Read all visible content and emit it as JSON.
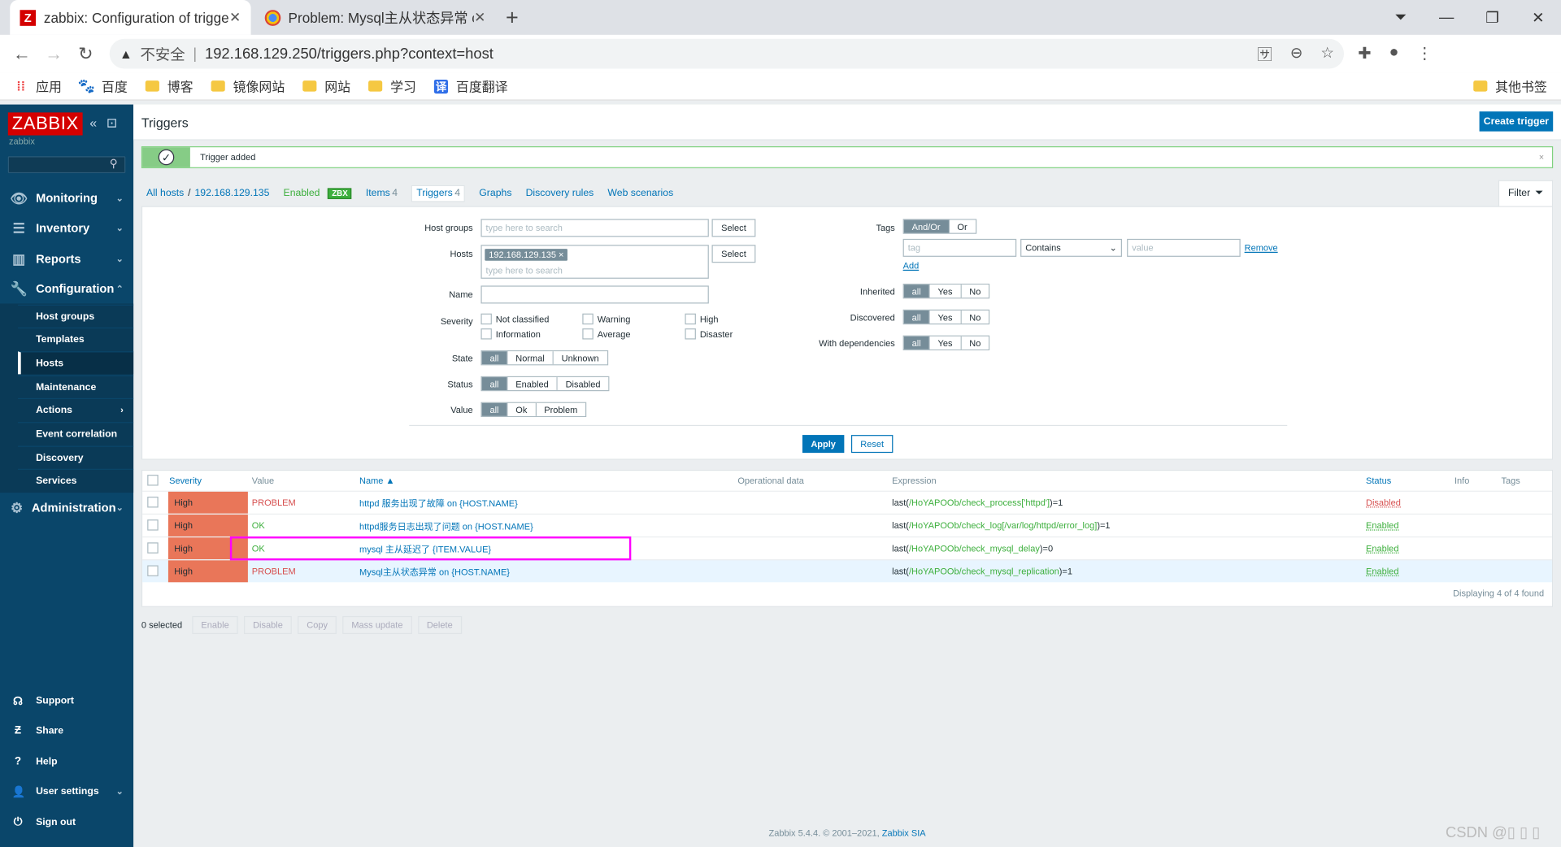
{
  "browser": {
    "tabs": [
      {
        "title": "zabbix: Configuration of trigge",
        "icon": "Z"
      },
      {
        "title": "Problem: Mysql主从状态异常 o",
        "icon": "chrome"
      }
    ],
    "url_warning": "不安全",
    "url": "192.168.129.250/triggers.php?context=host",
    "bookmarks": [
      "应用",
      "百度",
      "博客",
      "镜像网站",
      "网站",
      "学习",
      "百度翻译"
    ],
    "other_bookmarks": "其他书签"
  },
  "sidebar": {
    "logo": "ZABBIX",
    "user": "zabbix",
    "menu": [
      {
        "label": "Monitoring"
      },
      {
        "label": "Inventory"
      },
      {
        "label": "Reports"
      },
      {
        "label": "Configuration"
      },
      {
        "label": "Administration"
      }
    ],
    "submenu": [
      "Host groups",
      "Templates",
      "Hosts",
      "Maintenance",
      "Actions",
      "Event correlation",
      "Discovery",
      "Services"
    ],
    "footer": [
      "Support",
      "Share",
      "Help",
      "User settings",
      "Sign out"
    ]
  },
  "header": {
    "title": "Triggers",
    "create_button": "Create trigger"
  },
  "message": {
    "text": "Trigger added",
    "close": "×"
  },
  "hostnav": {
    "all_hosts": "All hosts",
    "sep": "/",
    "host": "192.168.129.135",
    "enabled": "Enabled",
    "zbx": "ZBX",
    "items": "Items",
    "items_count": "4",
    "triggers": "Triggers",
    "triggers_count": "4",
    "graphs": "Graphs",
    "discovery": "Discovery rules",
    "web": "Web scenarios"
  },
  "filter": {
    "tab_label": "Filter",
    "host_groups_label": "Host groups",
    "hosts_label": "Hosts",
    "name_label": "Name",
    "severity_label": "Severity",
    "state_label": "State",
    "status_label": "Status",
    "value_label": "Value",
    "placeholder": "type here to search",
    "select": "Select",
    "host_chip": "192.168.129.135",
    "severities": [
      "Not classified",
      "Information",
      "Warning",
      "Average",
      "High",
      "Disaster"
    ],
    "state": [
      "all",
      "Normal",
      "Unknown"
    ],
    "status": [
      "all",
      "Enabled",
      "Disabled"
    ],
    "value": [
      "all",
      "Ok",
      "Problem"
    ],
    "tags_label": "Tags",
    "tags_op": [
      "And/Or",
      "Or"
    ],
    "tag_placeholder": "tag",
    "tag_cond": "Contains",
    "value_placeholder": "value",
    "remove": "Remove",
    "add": "Add",
    "inherited_label": "Inherited",
    "discovered_label": "Discovered",
    "dependencies_label": "With dependencies",
    "yesno": [
      "all",
      "Yes",
      "No"
    ],
    "apply": "Apply",
    "reset": "Reset"
  },
  "table": {
    "headers": [
      "Severity",
      "Value",
      "Name ▲",
      "Operational data",
      "Expression",
      "Status",
      "Info",
      "Tags"
    ],
    "rows": [
      {
        "severity": "High",
        "value": "PROBLEM",
        "name": "httpd 服务出现了故障 on {HOST.NAME}",
        "expr_pre": "last(",
        "expr_key": "/HoYAPOOb/check_process['httpd']",
        "expr_post": ")=1",
        "status": "Disabled"
      },
      {
        "severity": "High",
        "value": "OK",
        "name": "httpd服务日志出现了问题 on {HOST.NAME}",
        "expr_pre": "last(",
        "expr_key": "/HoYAPOOb/check_log[/var/log/httpd/error_log]",
        "expr_post": ")=1",
        "status": "Enabled"
      },
      {
        "severity": "High",
        "value": "OK",
        "name": "mysql 主从延迟了 {ITEM.VALUE}",
        "expr_pre": "last(",
        "expr_key": "/HoYAPOOb/check_mysql_delay",
        "expr_post": ")=0",
        "status": "Enabled"
      },
      {
        "severity": "High",
        "value": "PROBLEM",
        "name": "Mysql主从状态异常 on {HOST.NAME}",
        "expr_pre": "last(",
        "expr_key": "/HoYAPOOb/check_mysql_replication",
        "expr_post": ")=1",
        "status": "Enabled"
      }
    ],
    "displaying": "Displaying 4 of 4 found"
  },
  "bulk": {
    "selected": "0 selected",
    "buttons": [
      "Enable",
      "Disable",
      "Copy",
      "Mass update",
      "Delete"
    ]
  },
  "footer": {
    "text": "Zabbix 5.4.4. © 2001–2021, ",
    "link": "Zabbix SIA"
  },
  "watermark": "CSDN @▯ ▯ ▯"
}
